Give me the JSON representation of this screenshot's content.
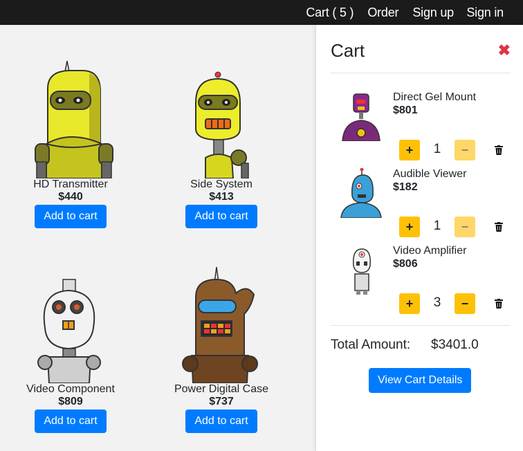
{
  "nav": {
    "cart_label": "Cart ( 5 )",
    "order_label": "Order",
    "signup_label": "Sign up",
    "signin_label": "Sign in"
  },
  "products": [
    {
      "name": "HD Transmitter",
      "price": "$440",
      "button": "Add to cart",
      "icon": "yellow-robot-icon"
    },
    {
      "name": "Side System",
      "price": "$413",
      "button": "Add to cart",
      "icon": "yellow-robot-icon"
    },
    {
      "name": "Video Component",
      "price": "$809",
      "button": "Add to cart",
      "icon": "white-robot-icon"
    },
    {
      "name": "Power Digital Case",
      "price": "$737",
      "button": "Add to cart",
      "icon": "brown-robot-icon"
    }
  ],
  "cart": {
    "title": "Cart",
    "close_icon": "close-icon",
    "items": [
      {
        "name": "Direct Gel Mount",
        "price": "$801",
        "qty": "1",
        "plus": "+",
        "minus": "−"
      },
      {
        "name": "Audible Viewer",
        "price": "$182",
        "qty": "1",
        "plus": "+",
        "minus": "−"
      },
      {
        "name": "Video Amplifier",
        "price": "$806",
        "qty": "3",
        "plus": "+",
        "minus": "−"
      }
    ],
    "total_label": "Total Amount:",
    "total_value": "$3401.0",
    "details_button": "View Cart Details"
  },
  "colors": {
    "topbar": "#1b1b1b",
    "primary": "#007bff",
    "warning": "#ffc107",
    "danger": "#dc3545"
  }
}
